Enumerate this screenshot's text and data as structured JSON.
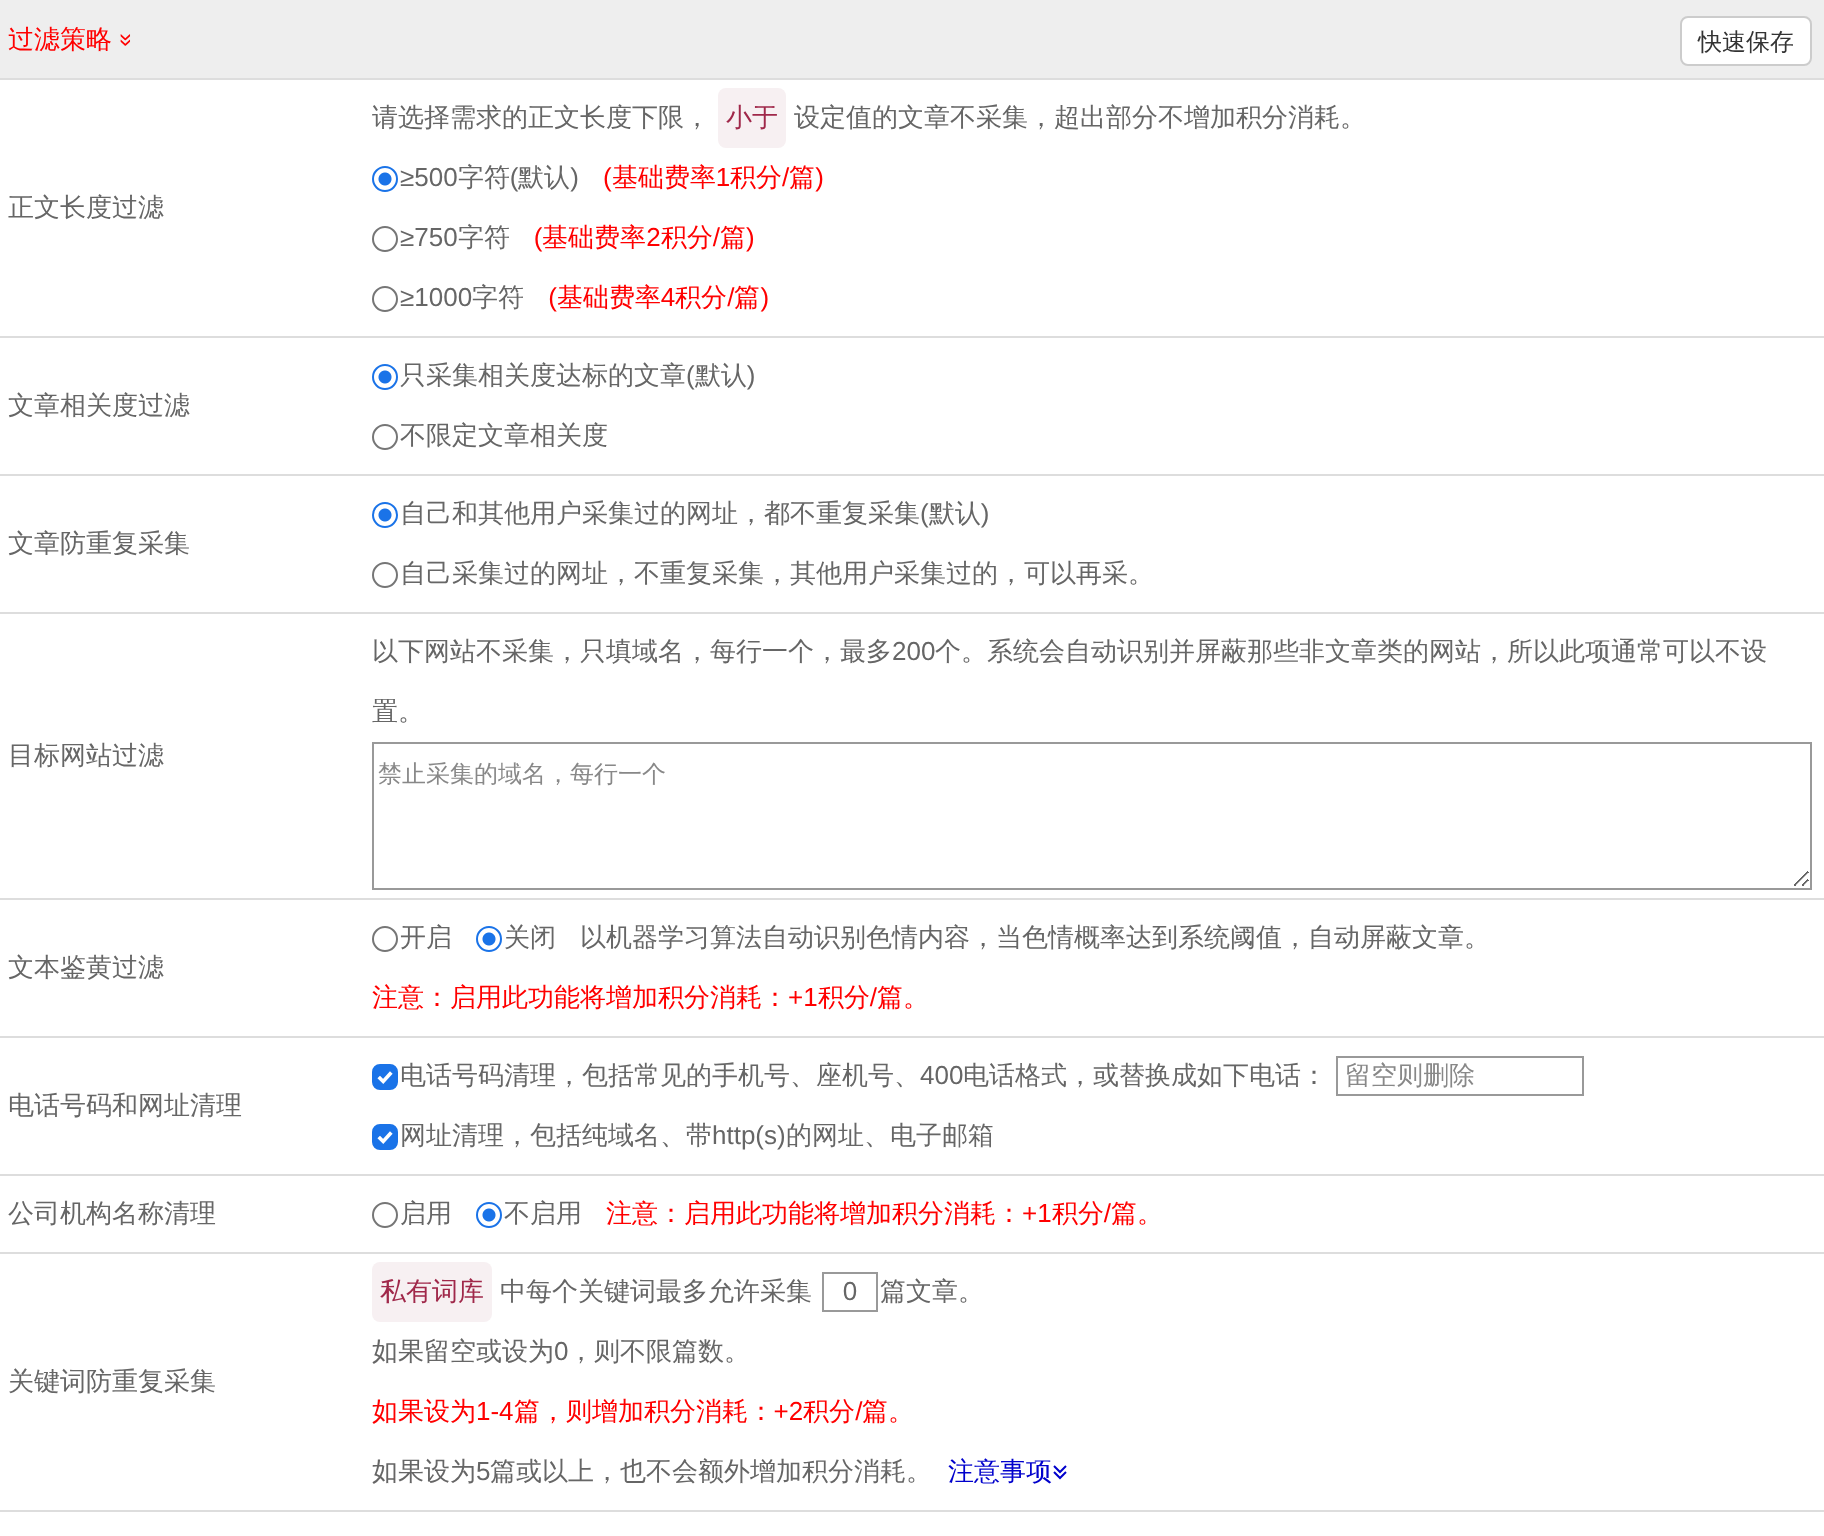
{
  "header": {
    "title": "过滤策略",
    "toggle": "»",
    "save_button": "快速保存"
  },
  "rows": [
    {
      "label": "正文长度过滤",
      "lines": [
        [
          {
            "kind": "text",
            "text": "请选择需求的正文长度下限，"
          },
          {
            "kind": "tag",
            "text": "小于"
          },
          {
            "kind": "text",
            "text": "设定值的文章不采集，超出部分不增加积分消耗。"
          }
        ],
        [
          {
            "kind": "radio",
            "label": "≥500字符(默认)",
            "selected": true
          },
          {
            "kind": "red",
            "text": "(基础费率1积分/篇)"
          }
        ],
        [
          {
            "kind": "radio",
            "label": "≥750字符",
            "selected": false
          },
          {
            "kind": "red",
            "text": "(基础费率2积分/篇)"
          }
        ],
        [
          {
            "kind": "radio",
            "label": "≥1000字符",
            "selected": false
          },
          {
            "kind": "red",
            "text": "(基础费率4积分/篇)"
          }
        ]
      ]
    },
    {
      "label": "文章相关度过滤",
      "lines": [
        [
          {
            "kind": "radio",
            "label": "只采集相关度达标的文章(默认)",
            "selected": true
          }
        ],
        [
          {
            "kind": "radio",
            "label": "不限定文章相关度",
            "selected": false
          }
        ]
      ]
    },
    {
      "label": "文章防重复采集",
      "lines": [
        [
          {
            "kind": "radio",
            "label": "自己和其他用户采集过的网址，都不重复采集(默认)",
            "selected": true
          }
        ],
        [
          {
            "kind": "radio",
            "label": "自己采集过的网址，不重复采集，其他用户采集过的，可以再采。",
            "selected": false
          }
        ]
      ]
    },
    {
      "label": "目标网站过滤",
      "lines": [
        [
          {
            "kind": "text",
            "text": "以下网站不采集，只填域名，每行一个，最多200个。系统会自动识别并屏蔽那些非文章类的网站，所以此项通常可以不设置。"
          }
        ],
        [
          {
            "kind": "textarea",
            "placeholder": "禁止采集的域名，每行一个"
          }
        ]
      ]
    },
    {
      "label": "文本鉴黄过滤",
      "lines": [
        [
          {
            "kind": "radio",
            "label": "开启",
            "selected": false
          },
          {
            "kind": "radio",
            "label": "关闭",
            "selected": true
          },
          {
            "kind": "text",
            "text": "以机器学习算法自动识别色情内容，当色情概率达到系统阈值，自动屏蔽文章。"
          }
        ],
        [
          {
            "kind": "red",
            "text": "注意：启用此功能将增加积分消耗：+1积分/篇。"
          }
        ]
      ]
    },
    {
      "label": "电话号码和网址清理",
      "lines": [
        [
          {
            "kind": "checkbox",
            "label": "电话号码清理，包括常见的手机号、座机号、400电话格式，或替换成如下电话：",
            "checked": true
          },
          {
            "kind": "input",
            "placeholder": "留空则删除"
          }
        ],
        [
          {
            "kind": "checkbox",
            "label": "网址清理，包括纯域名、带http(s)的网址、电子邮箱",
            "checked": true
          }
        ]
      ]
    },
    {
      "label": "公司机构名称清理",
      "lines": [
        [
          {
            "kind": "radio",
            "label": "启用",
            "selected": false
          },
          {
            "kind": "radio",
            "label": "不启用",
            "selected": true
          },
          {
            "kind": "red",
            "text": "注意：启用此功能将增加积分消耗：+1积分/篇。"
          }
        ]
      ]
    },
    {
      "label": "关键词防重复采集",
      "lines": [
        [
          {
            "kind": "tag",
            "text": "私有词库"
          },
          {
            "kind": "text",
            "text": "中每个关键词最多允许采集"
          },
          {
            "kind": "number",
            "value": "0"
          },
          {
            "kind": "text",
            "text": "篇文章。"
          }
        ],
        [
          {
            "kind": "text",
            "text": "如果留空或设为0，则不限篇数。"
          }
        ],
        [
          {
            "kind": "red",
            "text": "如果设为1-4篇，则增加积分消耗：+2积分/篇。"
          }
        ],
        [
          {
            "kind": "text",
            "text": "如果设为5篇或以上，也不会额外增加积分消耗。"
          },
          {
            "kind": "link",
            "text": "注意事项"
          }
        ]
      ]
    }
  ]
}
